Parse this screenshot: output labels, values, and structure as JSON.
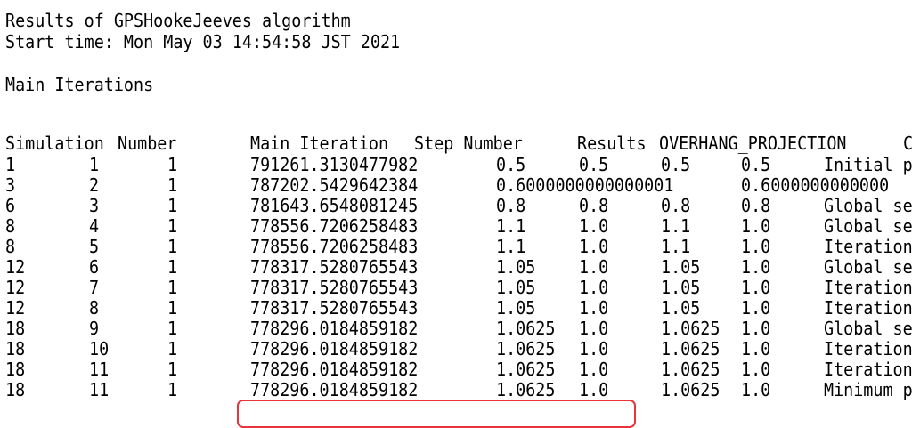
{
  "header": {
    "line1": "Results of GPSHookeJeeves algorithm",
    "line2": "Start time: Mon May 03 14:54:58 JST 2021",
    "section_title": "Main Iterations"
  },
  "table": {
    "headers": [
      "Simulation",
      "Number",
      "Main Iteration",
      "Step Number",
      "Results",
      "OVERHANG_PROJECTION",
      "C"
    ],
    "rows": [
      [
        "1",
        "1",
        "1",
        "791261.3130477982",
        "0.5",
        "0.5",
        "0.5",
        "0.5",
        "Initial p"
      ],
      [
        "3",
        "2",
        "1",
        "787202.5429642384",
        "0.6000000000000001",
        "",
        "",
        "0.6000000000000",
        ""
      ],
      [
        "6",
        "3",
        "1",
        "781643.6548081245",
        "0.8",
        "0.8",
        "0.8",
        "0.8",
        "Global se"
      ],
      [
        "8",
        "4",
        "1",
        "778556.7206258483",
        "1.1",
        "1.0",
        "1.1",
        "1.0",
        "Global se"
      ],
      [
        "8",
        "5",
        "1",
        "778556.7206258483",
        "1.1",
        "1.0",
        "1.1",
        "1.0",
        "Iteration"
      ],
      [
        "12",
        "6",
        "1",
        "778317.5280765543",
        "1.05",
        "1.0",
        "1.05",
        "1.0",
        "Global se"
      ],
      [
        "12",
        "7",
        "1",
        "778317.5280765543",
        "1.05",
        "1.0",
        "1.05",
        "1.0",
        "Iteration"
      ],
      [
        "12",
        "8",
        "1",
        "778317.5280765543",
        "1.05",
        "1.0",
        "1.05",
        "1.0",
        "Iteration"
      ],
      [
        "18",
        "9",
        "1",
        "778296.0184859182",
        "1.0625",
        "1.0",
        "1.0625",
        "1.0",
        "Global se"
      ],
      [
        "18",
        "10",
        "1",
        "778296.0184859182",
        "1.0625",
        "1.0",
        "1.0625",
        "1.0",
        "Iteration"
      ],
      [
        "18",
        "11",
        "1",
        "778296.0184859182",
        "1.0625",
        "1.0",
        "1.0625",
        "1.0",
        "Iteration"
      ],
      [
        "18",
        "11",
        "1",
        "778296.0184859182",
        "1.0625",
        "1.0",
        "1.0625",
        "1.0",
        "Minimum p"
      ]
    ]
  },
  "highlight": {
    "color": "#e8343a"
  }
}
